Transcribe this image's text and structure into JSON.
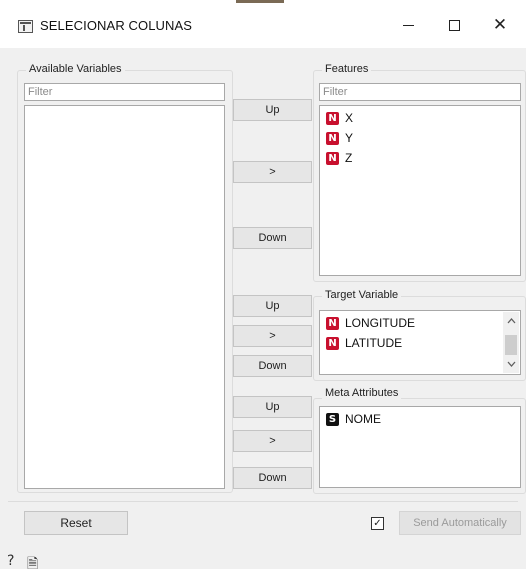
{
  "window": {
    "title": "SELECIONAR COLUNAS",
    "minimize_glyph": "",
    "maximize_glyph": "",
    "close_glyph": "✕"
  },
  "colors": {
    "numeric_badge": "#c8102e",
    "string_badge": "#111111",
    "panel_bg": "#f0f0f0"
  },
  "available": {
    "title": "Available Variables",
    "filter_placeholder": "Filter",
    "items": []
  },
  "features": {
    "title": "Features",
    "filter_placeholder": "Filter",
    "items": [
      {
        "badge": "N",
        "label": "X"
      },
      {
        "badge": "N",
        "label": "Y"
      },
      {
        "badge": "N",
        "label": "Z"
      }
    ],
    "up_label": "Up",
    "move_label": ">",
    "down_label": "Down"
  },
  "target": {
    "title": "Target Variable",
    "items": [
      {
        "badge": "N",
        "label": "LONGITUDE"
      },
      {
        "badge": "N",
        "label": "LATITUDE"
      }
    ],
    "up_label": "Up",
    "move_label": ">",
    "down_label": "Down"
  },
  "meta": {
    "title": "Meta Attributes",
    "items": [
      {
        "badge": "S",
        "label": "NOME"
      }
    ],
    "up_label": "Up",
    "move_label": ">",
    "down_label": "Down"
  },
  "footer": {
    "reset_label": "Reset",
    "auto_send_checked": true,
    "checkbox_glyph": "✓",
    "send_label": "Send Automatically",
    "help_icon": "?",
    "report_icon": "🗎"
  }
}
